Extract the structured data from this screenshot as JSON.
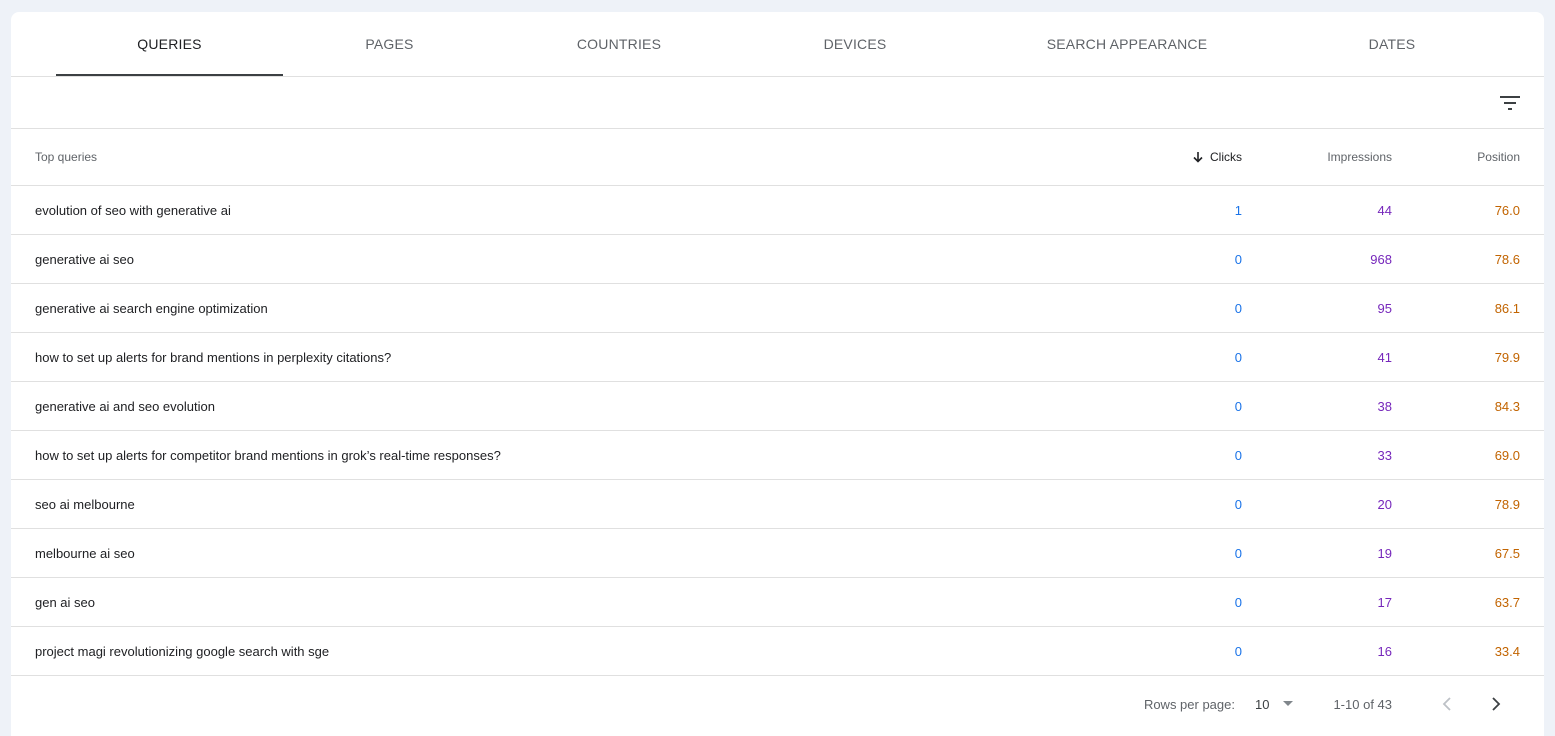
{
  "tabs": [
    {
      "label": "QUERIES",
      "active": true
    },
    {
      "label": "PAGES",
      "active": false
    },
    {
      "label": "COUNTRIES",
      "active": false
    },
    {
      "label": "DEVICES",
      "active": false
    },
    {
      "label": "SEARCH APPEARANCE",
      "active": false
    },
    {
      "label": "DATES",
      "active": false
    }
  ],
  "filter": {
    "icon": "filter-icon"
  },
  "table": {
    "headers": {
      "query": "Top queries",
      "clicks": "Clicks",
      "impressions": "Impressions",
      "position": "Position"
    },
    "sort": {
      "column": "clicks",
      "direction": "descending",
      "icon": "arrow-down-icon"
    },
    "rows": [
      {
        "query": "evolution of seo with generative ai",
        "clicks": "1",
        "impressions": "44",
        "position": "76.0"
      },
      {
        "query": "generative ai seo",
        "clicks": "0",
        "impressions": "968",
        "position": "78.6"
      },
      {
        "query": "generative ai search engine optimization",
        "clicks": "0",
        "impressions": "95",
        "position": "86.1"
      },
      {
        "query": "how to set up alerts for brand mentions in perplexity citations?",
        "clicks": "0",
        "impressions": "41",
        "position": "79.9"
      },
      {
        "query": "generative ai and seo evolution",
        "clicks": "0",
        "impressions": "38",
        "position": "84.3"
      },
      {
        "query": "how to set up alerts for competitor brand mentions in grok’s real-time responses?",
        "clicks": "0",
        "impressions": "33",
        "position": "69.0"
      },
      {
        "query": "seo ai melbourne",
        "clicks": "0",
        "impressions": "20",
        "position": "78.9"
      },
      {
        "query": "melbourne ai seo",
        "clicks": "0",
        "impressions": "19",
        "position": "67.5"
      },
      {
        "query": "gen ai seo",
        "clicks": "0",
        "impressions": "17",
        "position": "63.7"
      },
      {
        "query": "project magi revolutionizing google search with sge",
        "clicks": "0",
        "impressions": "16",
        "position": "33.4"
      }
    ]
  },
  "pagination": {
    "rows_per_page_label": "Rows per page:",
    "rows_per_page_value": "10",
    "range_label": "1-10 of 43",
    "prev_icon": "chevron-left-icon",
    "next_icon": "chevron-right-icon"
  },
  "colors": {
    "clicks": "#1a73e8",
    "impressions": "#7627bb",
    "position": "#c26401",
    "active_tab_indicator": "#3c4043"
  }
}
